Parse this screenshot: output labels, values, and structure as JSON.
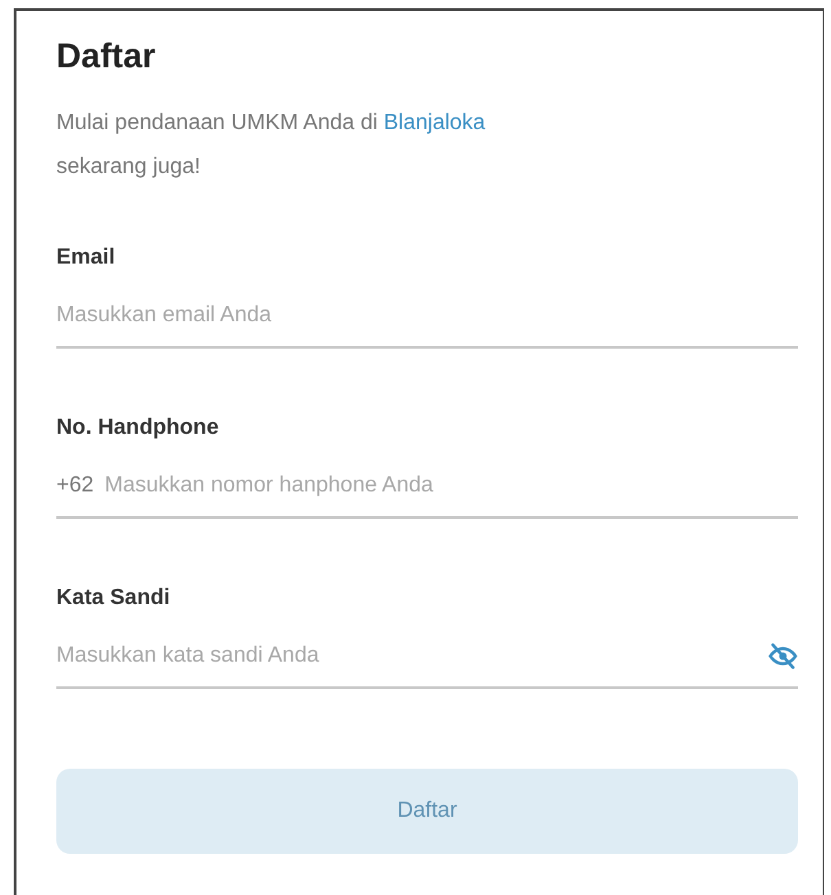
{
  "title": "Daftar",
  "intro": {
    "before": "Mulai pendanaan UMKM Anda di ",
    "link": "Blanjaloka",
    "after": "sekarang juga!"
  },
  "fields": [
    {
      "kind": "email",
      "label": "Email",
      "placeholder": "Masukkan email Anda"
    },
    {
      "kind": "phone",
      "label": "No. Handphone",
      "prefix": "+62",
      "placeholder": "Masukkan nomor hanphone Anda"
    },
    {
      "kind": "password",
      "label": "Kata Sandi",
      "placeholder": "Masukkan kata sandi Anda",
      "visible": false
    }
  ],
  "submit": {
    "label": "Daftar",
    "disabled": true
  }
}
